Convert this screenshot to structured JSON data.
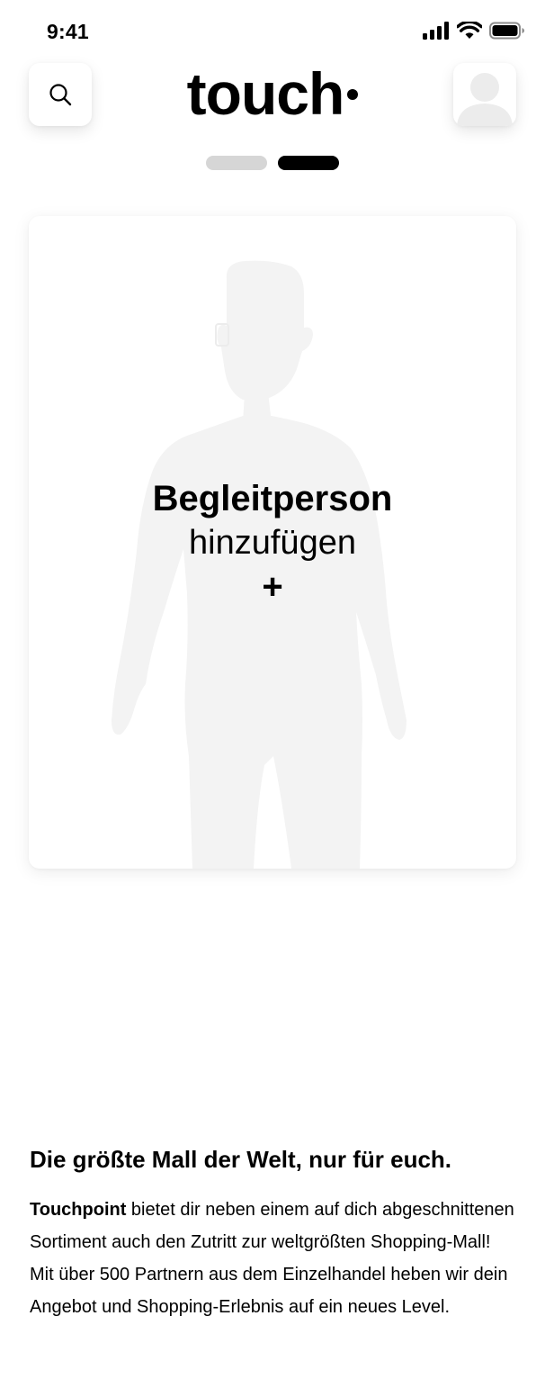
{
  "status_bar": {
    "time": "9:41",
    "icons": [
      "signal-icon",
      "wifi-icon",
      "battery-icon"
    ]
  },
  "header": {
    "logo_text": "touch",
    "search_icon": "search-icon",
    "avatar_icon": "avatar-icon"
  },
  "pager": {
    "count": 2,
    "active_index": 1
  },
  "companion_card": {
    "title": "Begleitperson",
    "subtitle": "hinzufügen",
    "plus": "+",
    "background_figure": "person-silhouette-icon"
  },
  "info": {
    "heading": "Die größte Mall der Welt, nur für euch.",
    "body_brand": "Touchpoint",
    "body_text": " bietet dir neben einem auf dich abgeschnittenen Sortiment auch den Zutritt zur weltgrößten Shopping-Mall! Mit über 500 Partnern aus dem Einzelhandel heben wir dein Angebot und Shopping-Erlebnis auf ein neues Level."
  },
  "colors": {
    "background": "#ffffff",
    "text": "#000000",
    "pager_inactive": "#d6d6d6",
    "pager_active": "#000000",
    "silhouette": "#f3f3f3"
  }
}
